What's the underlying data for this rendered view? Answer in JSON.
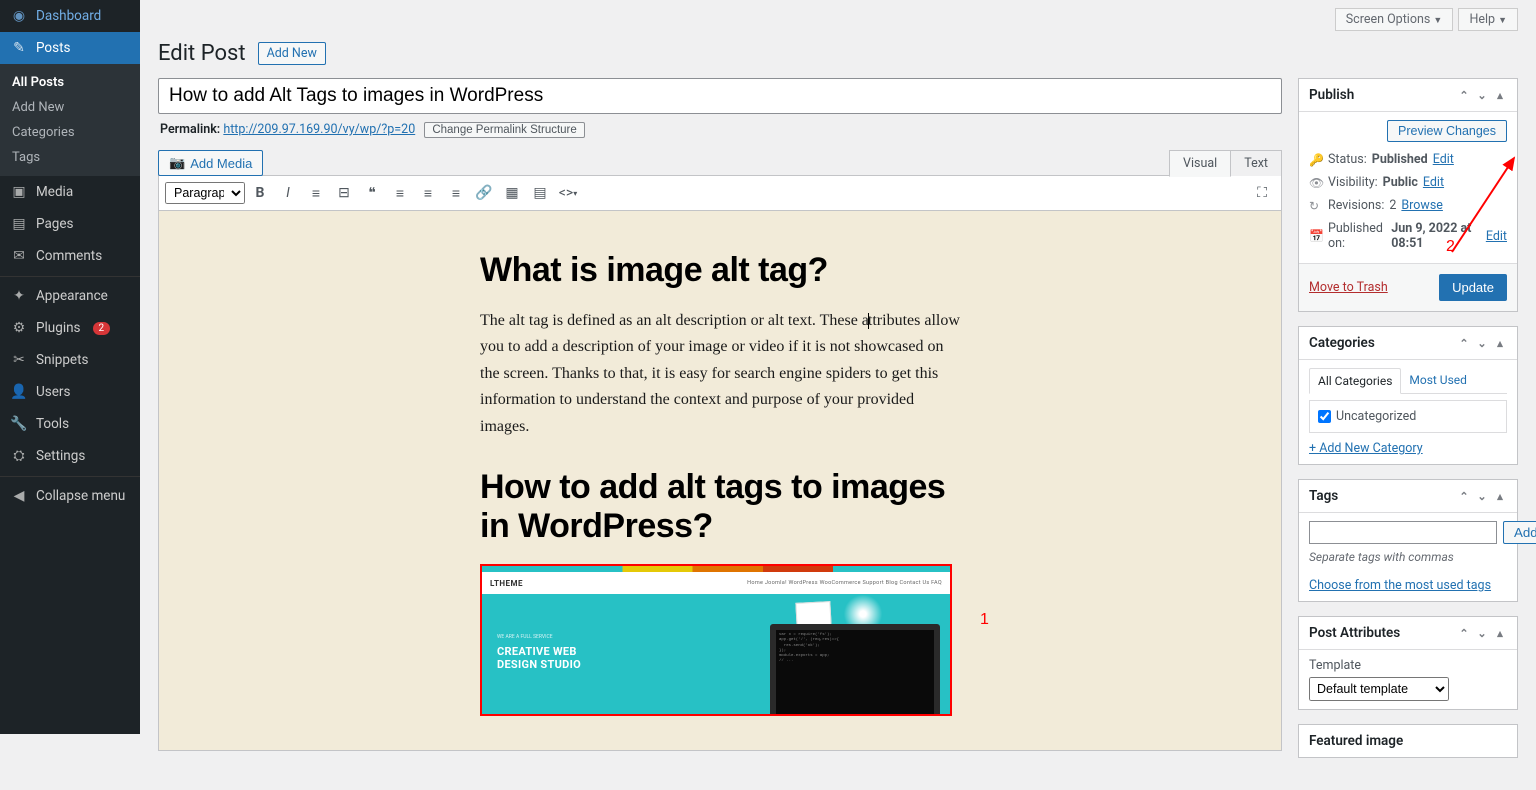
{
  "sidebar": {
    "dashboard": "Dashboard",
    "posts": "Posts",
    "all_posts": "All Posts",
    "add_new": "Add New",
    "categories": "Categories",
    "tags": "Tags",
    "media": "Media",
    "pages": "Pages",
    "comments": "Comments",
    "appearance": "Appearance",
    "plugins": "Plugins",
    "plugins_count": "2",
    "snippets": "Snippets",
    "users": "Users",
    "tools": "Tools",
    "settings": "Settings",
    "collapse": "Collapse menu"
  },
  "topbar": {
    "screen_options": "Screen Options",
    "help": "Help"
  },
  "header": {
    "title": "Edit Post",
    "add_new": "Add New"
  },
  "title_input": "How to add Alt Tags to images in WordPress",
  "permalink": {
    "label": "Permalink:",
    "url": "http://209.97.169.90/vy/wp/?p=20",
    "change": "Change Permalink Structure"
  },
  "media_btn": "Add Media",
  "tabs": {
    "visual": "Visual",
    "text": "Text"
  },
  "format_select": "Paragraph",
  "content": {
    "h1": "What is image alt tag?",
    "p1a": "The alt tag is defined as an alt description or alt text. These a",
    "p1b": "ttributes allow you to add a description of your image or video if it is not showcased on the screen. Thanks to that,  it is easy for search engine spiders to get this information to understand the context and purpose of your provided images.",
    "h2": "How to add alt tags to images in WordPress?",
    "img": {
      "logo": "LTHEME",
      "nav": "Home   Joomla!   WordPress   WooCommerce   Support   Blog   Contact Us   FAQ",
      "tagline": "WE ARE A FULL SERVICE",
      "title": "CREATIVE WEB\nDESIGN STUDIO"
    }
  },
  "annotations": {
    "one": "1",
    "two": "2"
  },
  "publish": {
    "title": "Publish",
    "preview": "Preview Changes",
    "status_label": "Status:",
    "status_value": "Published",
    "status_edit": "Edit",
    "vis_label": "Visibility:",
    "vis_value": "Public",
    "vis_edit": "Edit",
    "rev_label": "Revisions:",
    "rev_value": "2",
    "rev_browse": "Browse",
    "pub_label": "Published on:",
    "pub_value": "Jun 9, 2022 at 08:51",
    "pub_edit": "Edit",
    "trash": "Move to Trash",
    "update": "Update"
  },
  "categories": {
    "title": "Categories",
    "tab_all": "All Categories",
    "tab_most": "Most Used",
    "item1": "Uncategorized",
    "add_new": "+ Add New Category"
  },
  "tags": {
    "title": "Tags",
    "add": "Add",
    "hint": "Separate tags with commas",
    "choose": "Choose from the most used tags"
  },
  "attrs": {
    "title": "Post Attributes",
    "template_label": "Template",
    "template_value": "Default template"
  },
  "featured": {
    "title": "Featured image"
  }
}
